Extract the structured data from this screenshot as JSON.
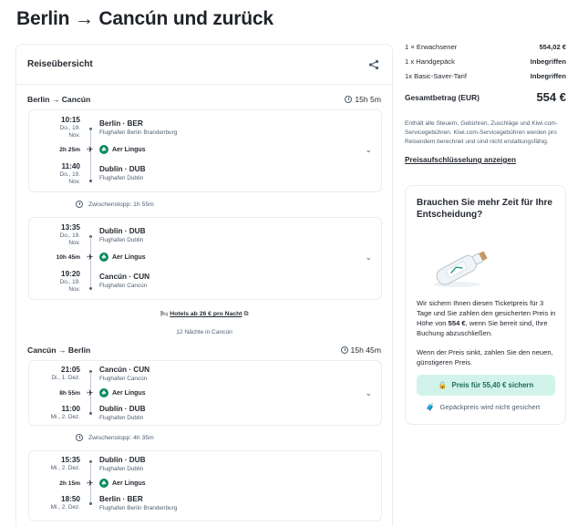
{
  "page": {
    "title": "Berlin → Cancún und zurück"
  },
  "overview": {
    "label": "Reiseübersicht"
  },
  "outbound": {
    "title": "Berlin → Cancún",
    "duration": "15h 5m",
    "seg1": {
      "dep_time": "10:15",
      "dep_date": "Do., 19.",
      "dep_month": "Nov.",
      "dep_place": "Berlin · BER",
      "dep_airport": "Flughafen Berlin Brandenburg",
      "flight_dur": "2h 25m",
      "airline": "Aer Lingus",
      "arr_time": "11:40",
      "arr_date": "Do., 19.",
      "arr_month": "Nov.",
      "arr_place": "Dublin · DUB",
      "arr_airport": "Flughafen Dublin"
    },
    "stop": "Zwischenstopp: 1h 55m",
    "seg2": {
      "dep_time": "13:35",
      "dep_date": "Do., 19.",
      "dep_month": "Nov.",
      "dep_place": "Dublin · DUB",
      "dep_airport": "Flughafen Dublin",
      "flight_dur": "10h 45m",
      "airline": "Aer Lingus",
      "arr_time": "19:20",
      "arr_date": "Do., 19.",
      "arr_month": "Nov.",
      "arr_place": "Cancún · CUN",
      "arr_airport": "Flughafen Cancún"
    }
  },
  "hotels": {
    "prefix": "Hotels ab",
    "price": "26 €",
    "suffix": "pro Nacht",
    "nights": "12 Nächte in Cancún"
  },
  "inbound": {
    "title": "Cancún → Berlin",
    "duration": "15h 45m",
    "seg1": {
      "dep_time": "21:05",
      "dep_date": "Di., 1. Dez.",
      "dep_place": "Cancún · CUN",
      "dep_airport": "Flughafen Cancún",
      "flight_dur": "8h 55m",
      "airline": "Aer Lingus",
      "arr_time": "11:00",
      "arr_date": "Mi., 2. Dez.",
      "arr_place": "Dublin · DUB",
      "arr_airport": "Flughafen Dublin"
    },
    "stop": "Zwischenstopp: 4h 35m",
    "seg2": {
      "dep_time": "15:35",
      "dep_date": "Mi., 2. Dez.",
      "dep_place": "Dublin · DUB",
      "dep_airport": "Flughafen Dublin",
      "flight_dur": "2h 15m",
      "airline": "Aer Lingus",
      "arr_time": "18:50",
      "arr_date": "Mi., 2. Dez.",
      "arr_place": "Berlin · BER",
      "arr_airport": "Flughafen Berlin Brandenburg"
    }
  },
  "summary": {
    "rows": [
      {
        "label": "1 × Erwachsener",
        "value": "554,02 €"
      },
      {
        "label": "1 x Handgepäck",
        "value": "Inbegriffen"
      },
      {
        "label": "1x Basic-Saver-Tarif",
        "value": "Inbegriffen"
      }
    ],
    "total_label": "Gesamtbetrag (EUR)",
    "total_value": "554 €",
    "note": "Enthält alle Steuern, Gebühren, Zuschläge und Kiwi.com-Servicegebühren. Kiwi.com-Servicegebühren werden pro Reisendem berechnet und sind nicht erstattungsfähig.",
    "breakdown": "Preisaufschlüsselung anzeigen"
  },
  "offer": {
    "title": "Brauchen Sie mehr Zeit für Ihre Entscheidung?",
    "p1a": "Wir sichern Ihnen diesen Ticketpreis für 3 Tage und Sie zahlen den gesicherten Preis in Höhe von ",
    "p1price": "554 €",
    "p1b": ", wenn Sie bereit sind, Ihre Buchung abzuschließen.",
    "p2": "Wenn der Preis sinkt, zahlen Sie den neuen, günstigeren Preis.",
    "button": "Preis für 55,40 € sichern",
    "baggage": "Gepäckpreis wird nicht gesichert"
  },
  "colors": {
    "accent": "#0e8a5f",
    "button_bg": "#d1f3ea",
    "button_text": "#1d6e55"
  }
}
